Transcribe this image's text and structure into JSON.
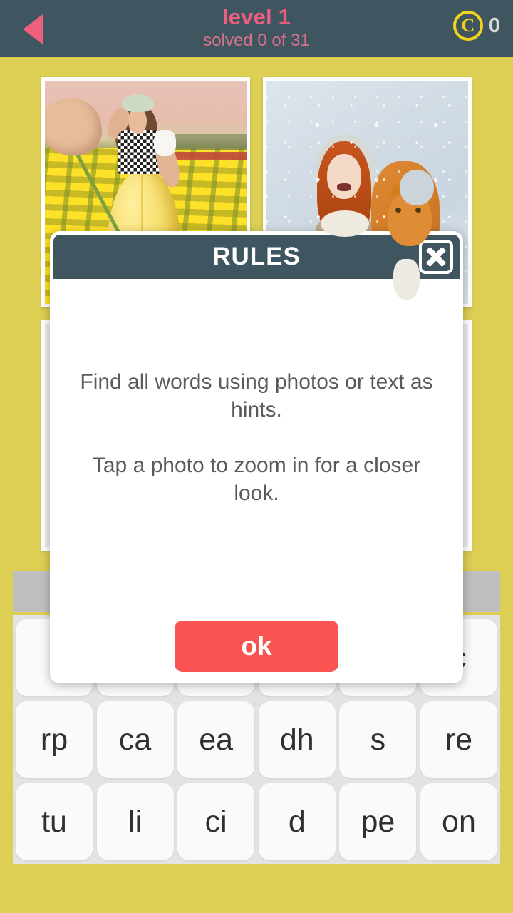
{
  "header": {
    "back_icon": "back-arrow-icon",
    "level_title": "level 1",
    "solved_text": "solved 0 of 31",
    "coin_icon": "coin-icon",
    "coin_symbol": "C",
    "coin_count": "0",
    "colors": {
      "bar_background": "#3F5560",
      "accent_pink": "#EC5F7F",
      "coin_yellow": "#F2D31C"
    }
  },
  "background_color": "#DCCF53",
  "photos": [
    {
      "alt": "woman in yellow tulip field holding giant tulip",
      "visible": true
    },
    {
      "alt": "red-haired girl holding ginger cat in snow",
      "visible": true
    },
    {
      "alt": "hidden photo behind rules dialog",
      "visible": false
    },
    {
      "alt": "hidden photo behind rules dialog",
      "visible": false
    }
  ],
  "word_slot_strip": {
    "label": "answer-slot-strip",
    "color": "#BFBFBF"
  },
  "keyboard": {
    "background_color": "#E3E3E3",
    "rows": [
      [
        "",
        "",
        "",
        "",
        "",
        "c"
      ],
      [
        "rp",
        "ca",
        "ea",
        "dh",
        "s",
        "re"
      ],
      [
        "tu",
        "li",
        "ci",
        "d",
        "pe",
        "on"
      ]
    ]
  },
  "modal": {
    "title": "RULES",
    "close_icon": "close-x-icon",
    "line1": "Find all words using photos or text as hints.",
    "line2": "Tap a photo to zoom in for a closer look.",
    "ok_label": "ok",
    "colors": {
      "header_background": "#3F5560",
      "ok_button": "#FB5252",
      "body_text": "#5A5A5A"
    }
  }
}
